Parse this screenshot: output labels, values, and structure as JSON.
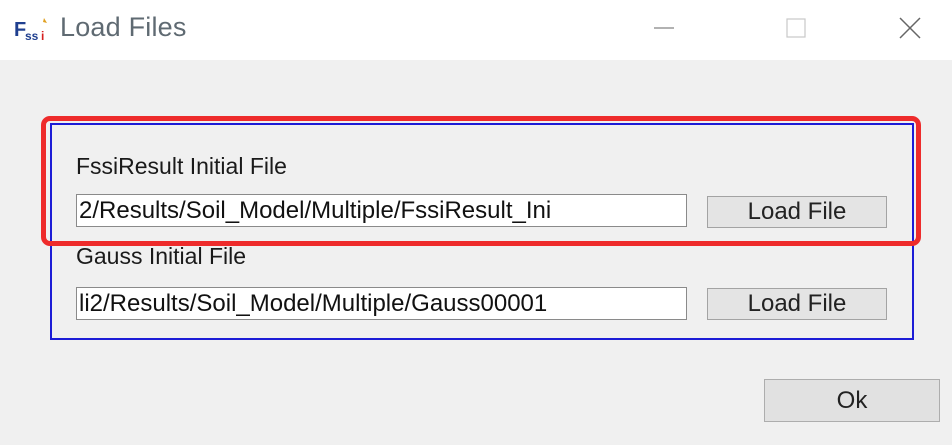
{
  "window": {
    "title": "Load Files",
    "icon_text": "Fssi",
    "icon": "fssi-app-icon"
  },
  "title_controls": {
    "minimize_icon": "minimize-icon",
    "maximize_icon": "maximize-icon",
    "close_icon": "close-icon"
  },
  "fssi_result": {
    "label": "FssiResult Initial File",
    "path": "2/Results/Soil_Model/Multiple/FssiResult_Ini",
    "button_label": "Load File"
  },
  "gauss": {
    "label": "Gauss Initial File",
    "path": "li2/Results/Soil_Model/Multiple/Gauss00001",
    "button_label": "Load File"
  },
  "ok_button_label": "Ok",
  "colors": {
    "highlight": "#ee2b2b",
    "group_border": "#1c1cd6",
    "dialog_background": "#f0f0f0"
  }
}
